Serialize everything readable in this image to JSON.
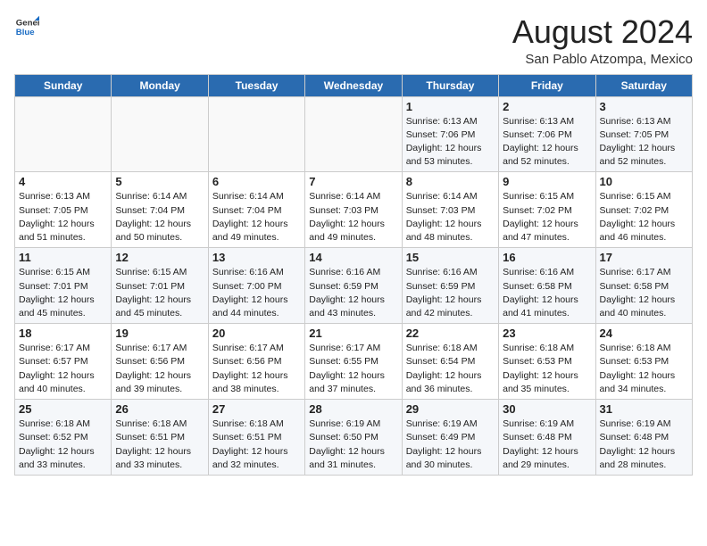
{
  "header": {
    "logo_general": "General",
    "logo_blue": "Blue",
    "month_year": "August 2024",
    "location": "San Pablo Atzompa, Mexico"
  },
  "days_of_week": [
    "Sunday",
    "Monday",
    "Tuesday",
    "Wednesday",
    "Thursday",
    "Friday",
    "Saturday"
  ],
  "weeks": [
    [
      {
        "day": "",
        "info": ""
      },
      {
        "day": "",
        "info": ""
      },
      {
        "day": "",
        "info": ""
      },
      {
        "day": "",
        "info": ""
      },
      {
        "day": "1",
        "info": "Sunrise: 6:13 AM\nSunset: 7:06 PM\nDaylight: 12 hours\nand 53 minutes."
      },
      {
        "day": "2",
        "info": "Sunrise: 6:13 AM\nSunset: 7:06 PM\nDaylight: 12 hours\nand 52 minutes."
      },
      {
        "day": "3",
        "info": "Sunrise: 6:13 AM\nSunset: 7:05 PM\nDaylight: 12 hours\nand 52 minutes."
      }
    ],
    [
      {
        "day": "4",
        "info": "Sunrise: 6:13 AM\nSunset: 7:05 PM\nDaylight: 12 hours\nand 51 minutes."
      },
      {
        "day": "5",
        "info": "Sunrise: 6:14 AM\nSunset: 7:04 PM\nDaylight: 12 hours\nand 50 minutes."
      },
      {
        "day": "6",
        "info": "Sunrise: 6:14 AM\nSunset: 7:04 PM\nDaylight: 12 hours\nand 49 minutes."
      },
      {
        "day": "7",
        "info": "Sunrise: 6:14 AM\nSunset: 7:03 PM\nDaylight: 12 hours\nand 49 minutes."
      },
      {
        "day": "8",
        "info": "Sunrise: 6:14 AM\nSunset: 7:03 PM\nDaylight: 12 hours\nand 48 minutes."
      },
      {
        "day": "9",
        "info": "Sunrise: 6:15 AM\nSunset: 7:02 PM\nDaylight: 12 hours\nand 47 minutes."
      },
      {
        "day": "10",
        "info": "Sunrise: 6:15 AM\nSunset: 7:02 PM\nDaylight: 12 hours\nand 46 minutes."
      }
    ],
    [
      {
        "day": "11",
        "info": "Sunrise: 6:15 AM\nSunset: 7:01 PM\nDaylight: 12 hours\nand 45 minutes."
      },
      {
        "day": "12",
        "info": "Sunrise: 6:15 AM\nSunset: 7:01 PM\nDaylight: 12 hours\nand 45 minutes."
      },
      {
        "day": "13",
        "info": "Sunrise: 6:16 AM\nSunset: 7:00 PM\nDaylight: 12 hours\nand 44 minutes."
      },
      {
        "day": "14",
        "info": "Sunrise: 6:16 AM\nSunset: 6:59 PM\nDaylight: 12 hours\nand 43 minutes."
      },
      {
        "day": "15",
        "info": "Sunrise: 6:16 AM\nSunset: 6:59 PM\nDaylight: 12 hours\nand 42 minutes."
      },
      {
        "day": "16",
        "info": "Sunrise: 6:16 AM\nSunset: 6:58 PM\nDaylight: 12 hours\nand 41 minutes."
      },
      {
        "day": "17",
        "info": "Sunrise: 6:17 AM\nSunset: 6:58 PM\nDaylight: 12 hours\nand 40 minutes."
      }
    ],
    [
      {
        "day": "18",
        "info": "Sunrise: 6:17 AM\nSunset: 6:57 PM\nDaylight: 12 hours\nand 40 minutes."
      },
      {
        "day": "19",
        "info": "Sunrise: 6:17 AM\nSunset: 6:56 PM\nDaylight: 12 hours\nand 39 minutes."
      },
      {
        "day": "20",
        "info": "Sunrise: 6:17 AM\nSunset: 6:56 PM\nDaylight: 12 hours\nand 38 minutes."
      },
      {
        "day": "21",
        "info": "Sunrise: 6:17 AM\nSunset: 6:55 PM\nDaylight: 12 hours\nand 37 minutes."
      },
      {
        "day": "22",
        "info": "Sunrise: 6:18 AM\nSunset: 6:54 PM\nDaylight: 12 hours\nand 36 minutes."
      },
      {
        "day": "23",
        "info": "Sunrise: 6:18 AM\nSunset: 6:53 PM\nDaylight: 12 hours\nand 35 minutes."
      },
      {
        "day": "24",
        "info": "Sunrise: 6:18 AM\nSunset: 6:53 PM\nDaylight: 12 hours\nand 34 minutes."
      }
    ],
    [
      {
        "day": "25",
        "info": "Sunrise: 6:18 AM\nSunset: 6:52 PM\nDaylight: 12 hours\nand 33 minutes."
      },
      {
        "day": "26",
        "info": "Sunrise: 6:18 AM\nSunset: 6:51 PM\nDaylight: 12 hours\nand 33 minutes."
      },
      {
        "day": "27",
        "info": "Sunrise: 6:18 AM\nSunset: 6:51 PM\nDaylight: 12 hours\nand 32 minutes."
      },
      {
        "day": "28",
        "info": "Sunrise: 6:19 AM\nSunset: 6:50 PM\nDaylight: 12 hours\nand 31 minutes."
      },
      {
        "day": "29",
        "info": "Sunrise: 6:19 AM\nSunset: 6:49 PM\nDaylight: 12 hours\nand 30 minutes."
      },
      {
        "day": "30",
        "info": "Sunrise: 6:19 AM\nSunset: 6:48 PM\nDaylight: 12 hours\nand 29 minutes."
      },
      {
        "day": "31",
        "info": "Sunrise: 6:19 AM\nSunset: 6:48 PM\nDaylight: 12 hours\nand 28 minutes."
      }
    ]
  ]
}
